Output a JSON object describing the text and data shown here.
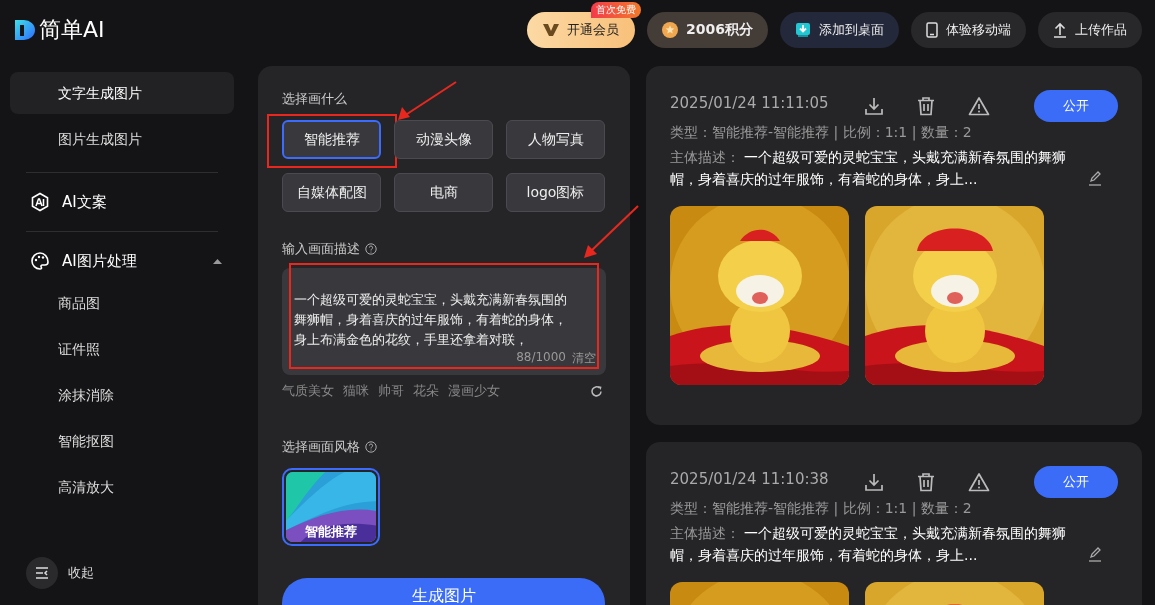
{
  "logo": {
    "text": "简单AI"
  },
  "header_buttons": [
    {
      "kind": "vip",
      "label": "开通会员",
      "badge": "首次免费"
    },
    {
      "kind": "points",
      "label": "2006积分"
    },
    {
      "kind": "desktop",
      "label": "添加到桌面"
    },
    {
      "kind": "mobile",
      "label": "体验移动端"
    },
    {
      "kind": "upload",
      "label": "上传作品"
    }
  ],
  "sidebar": {
    "items": [
      {
        "kind": "link",
        "label": "文字生成图片",
        "selected": true
      },
      {
        "kind": "link",
        "label": "图片生成图片",
        "selected": false
      },
      {
        "kind": "copywriting",
        "label": "AI文案"
      },
      {
        "kind": "imaging",
        "label": "AI图片处理",
        "expanded": true,
        "children": [
          {
            "label": "商品图",
            "selected": false
          },
          {
            "label": "证件照",
            "selected": false
          },
          {
            "label": "涂抹消除",
            "selected": false
          },
          {
            "label": "智能抠图",
            "selected": false
          },
          {
            "label": "高清放大",
            "selected": false
          }
        ]
      }
    ],
    "collapse": {
      "label": "收起"
    }
  },
  "form": {
    "category_label": "选择画什么",
    "categories": [
      {
        "label": "智能推荐",
        "selected": true,
        "annotated": true
      },
      {
        "label": "动漫头像",
        "selected": false,
        "annotated": false
      },
      {
        "label": "人物写真",
        "selected": false,
        "annotated": false
      },
      {
        "label": "自媒体配图",
        "selected": false,
        "annotated": false
      },
      {
        "label": "电商",
        "selected": false,
        "annotated": false
      },
      {
        "label": "logo图标",
        "selected": false,
        "annotated": false
      }
    ],
    "prompt_label": "输入画面描述",
    "prompt": {
      "value": "一个超级可爱的灵蛇宝宝，头戴充满新春氛围的舞狮帽，身着喜庆的过年服饰，有着蛇的身体，身上布满金色的花纹，手里还拿着对联，",
      "counter": "88/1000",
      "clear": "清空",
      "annotated": true
    },
    "suggestions": [
      "气质美女",
      "猫咪",
      "帅哥",
      "花朵",
      "漫画少女"
    ],
    "style_label": "选择画面风格",
    "styles": [
      {
        "label": "智能推荐",
        "selected": true
      }
    ],
    "generate": "生成图片"
  },
  "results": [
    {
      "time": "2025/01/24 11:11:05",
      "type_line": "类型：智能推荐-智能推荐 | 比例：1:1 | 数量：2",
      "desc_label": "主体描述：",
      "desc": "一个超级可爱的灵蛇宝宝，头戴充满新春氛围的舞狮帽，身着喜庆的过年服饰，有着蛇的身体，身上...",
      "publish": "公开"
    },
    {
      "time": "2025/01/24 11:10:38",
      "type_line": "类型：智能推荐-智能推荐 | 比例：1:1 | 数量：2",
      "desc_label": "主体描述：",
      "desc": "一个超级可爱的灵蛇宝宝，头戴充满新春氛围的舞狮帽，身着喜庆的过年服饰，有着蛇的身体，身上...",
      "publish": "公开"
    }
  ]
}
